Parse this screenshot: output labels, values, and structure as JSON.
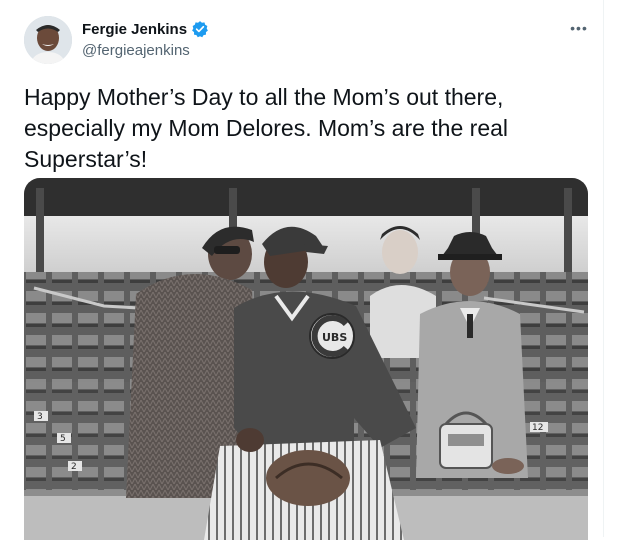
{
  "author": {
    "display_name": "Fergie Jenkins",
    "handle": "@fergieajenkins",
    "verified": true
  },
  "tweet": {
    "text": "Happy Mother’s Day to all the Mom’s out there, especially my Mom Delores. Mom’s are the real Superstar’s!"
  },
  "media": {
    "jacket_logo": "UBS",
    "seat_numbers": [
      "5",
      "2",
      "3",
      "12"
    ]
  },
  "icons": {
    "verified": "verified-badge-icon",
    "more": "more-options-icon"
  },
  "colors": {
    "text": "#0f1419",
    "secondary": "#536471",
    "verified_blue": "#1d9bf0"
  }
}
